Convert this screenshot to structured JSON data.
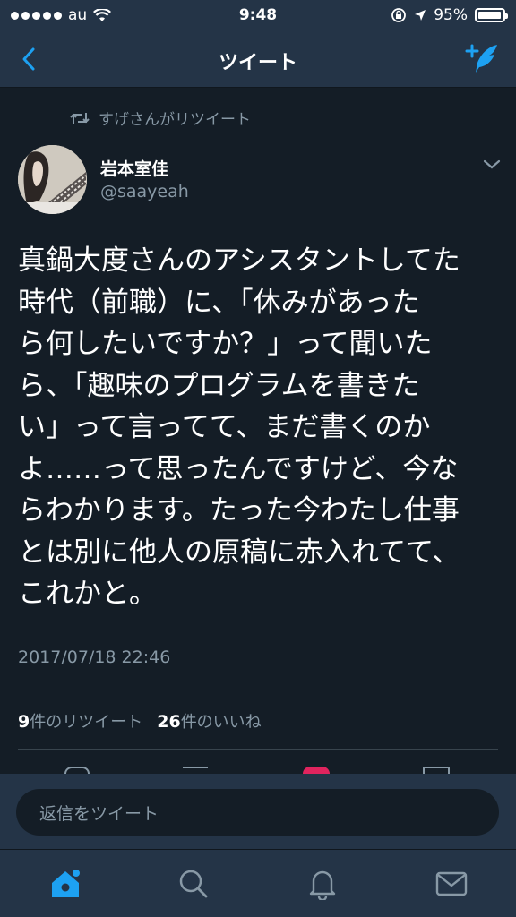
{
  "status_bar": {
    "carrier": "au",
    "time": "9:48",
    "battery_percent": "95%",
    "battery_level": 0.95
  },
  "nav": {
    "title": "ツイート",
    "back_icon": "chevron-left-icon",
    "compose_icon": "compose-tweet-icon"
  },
  "tweet": {
    "retweet_context": "すげさんがリツイート",
    "author_name": "岩本室佳",
    "author_handle": "@saayeah",
    "text": "真鍋大度さんのアシスタントしてた\n時代（前職）に、「休みがあった\nら何したいですか？」って聞いた\nら、「趣味のプログラムを書きた\nい」って言ってて、まだ書くのか\nよ……って思ったんですけど、今な\nらわかります。たった今わたし仕事\nとは別に他人の原稿に赤入れてて、\nこれかと。",
    "timestamp": "2017/07/18 22:46",
    "retweet_count": "9",
    "retweet_label": "件のリツイート",
    "like_count": "26",
    "like_label": "件のいいね"
  },
  "reply": {
    "placeholder": "返信をツイート"
  },
  "tabs": [
    {
      "name": "home",
      "icon": "home-icon",
      "active": true
    },
    {
      "name": "search",
      "icon": "search-icon",
      "active": false
    },
    {
      "name": "notifications",
      "icon": "bell-icon",
      "active": false
    },
    {
      "name": "messages",
      "icon": "mail-icon",
      "active": false
    }
  ],
  "colors": {
    "background": "#141d26",
    "bar": "#243447",
    "accent": "#1da1f2",
    "secondary_text": "#8899a6",
    "like": "#e0245e"
  }
}
